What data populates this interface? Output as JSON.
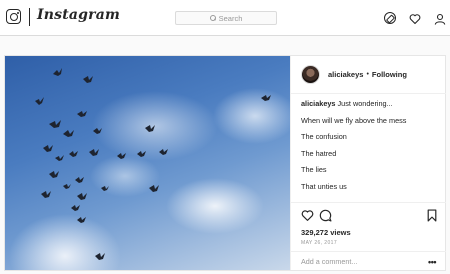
{
  "header": {
    "brand": "Instagram",
    "search_placeholder": "Search"
  },
  "post": {
    "owner": "aliciakeys",
    "separator": "•",
    "follow_label": "Following",
    "caption_user": "aliciakeys",
    "caption_lines": [
      "Just wondering...",
      "When will we fly above the mess",
      "The confusion",
      "The hatred",
      "The lies",
      "That unties us"
    ],
    "views": "329,272 views",
    "date": "MAY 26, 2017",
    "comment_placeholder": "Add a comment...",
    "more_label": "•••"
  },
  "colors": {
    "text": "#262626",
    "muted": "#999999",
    "border": "#dbdbdb",
    "background": "#fafafa"
  },
  "icons": {
    "logo": "instagram-camera-icon",
    "explore": "compass-icon",
    "activity": "heart-icon",
    "profile": "person-icon",
    "like": "heart-icon",
    "comment": "speech-bubble-icon",
    "save": "bookmark-icon"
  }
}
